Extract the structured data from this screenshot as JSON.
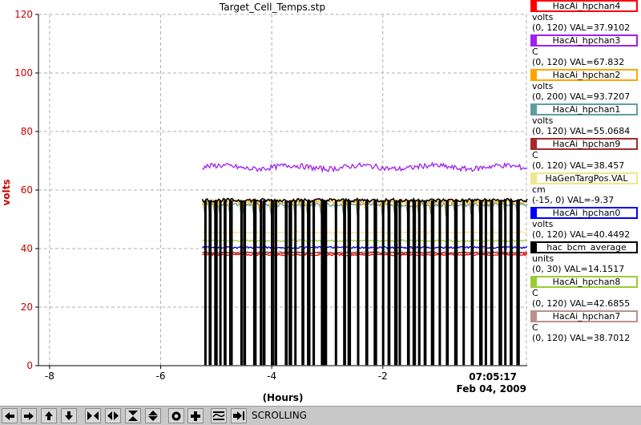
{
  "window": {
    "title": "Target_Cell_Temps.stp"
  },
  "axes": {
    "y_label": "volts",
    "x_label": "(Hours)",
    "x_ticks": [
      "-8",
      "-6",
      "-4",
      "-2"
    ],
    "y_ticks": [
      "0",
      "20",
      "40",
      "60",
      "80",
      "100",
      "120"
    ],
    "timestamp_time": "07:05:17",
    "timestamp_date": "Feb 04, 2009",
    "colors": {
      "y_axis": "#cc0000",
      "grid": "#b0b0b0"
    }
  },
  "chart_data": {
    "type": "line",
    "title": "Target_Cell_Temps.stp",
    "xlabel": "(Hours)",
    "ylabel": "volts",
    "xlim": [
      -8.2,
      0.6
    ],
    "ylim": [
      0,
      120
    ],
    "grid": true,
    "legend_position": "right",
    "series": [
      {
        "name": "HacAi_hpchan4",
        "color": "#ff0000",
        "start": -5.25,
        "level": 37.9
      },
      {
        "name": "HacAi_hpchan3",
        "color": "#a020f0",
        "start": -5.25,
        "level": 67.8
      },
      {
        "name": "HacAi_hpchan2",
        "color": "#ffa500",
        "start": -5.25,
        "level": 56.0
      },
      {
        "name": "HacAi_hpchan1",
        "color": "#5f9ea0",
        "start": -5.25,
        "level": 55.0
      },
      {
        "name": "HacAi_hpchan9",
        "color": "#a52a2a",
        "start": -5.25,
        "level": 38.5
      },
      {
        "name": "HaGenTargPos.VAL",
        "color": "#f0e68c",
        "start": -5.25,
        "level": 45.5
      },
      {
        "name": "HacAi_hpchan0",
        "color": "#0000ff",
        "start": -5.25,
        "level": 40.4
      },
      {
        "name": "hac_bcm_average",
        "color": "#000000",
        "start": -5.25,
        "level": 56.5
      },
      {
        "name": "HacAi_hpchan8",
        "color": "#9acd32",
        "start": -5.25,
        "level": 42.7
      },
      {
        "name": "HacAi_hpchan7",
        "color": "#bc8f8f",
        "start": -5.25,
        "level": 38.7
      }
    ],
    "bcm_dropouts": [
      -5.2,
      -5.12,
      -5.02,
      -4.93,
      -4.85,
      -4.75,
      -4.55,
      -4.5,
      -4.32,
      -4.2,
      -4.15,
      -4.0,
      -3.93,
      -3.75,
      -3.68,
      -3.58,
      -3.45,
      -3.35,
      -3.25,
      -3.1,
      -3.05,
      -2.85,
      -2.7,
      -2.62,
      -2.45,
      -2.3,
      -2.15,
      -2.0,
      -1.9,
      -1.78,
      -1.7,
      -1.55,
      -1.45,
      -1.35,
      -1.25,
      -1.12,
      -0.98,
      -0.85,
      -0.7,
      -0.55,
      -0.4,
      -0.25,
      -0.15,
      -0.05,
      0.1,
      0.2,
      0.3,
      0.42
    ]
  },
  "legend": [
    {
      "name": "HacAi_hpchan4",
      "unit": "volts",
      "range": "(0, 120) VAL=37.9102",
      "color": "#ff0000"
    },
    {
      "name": "HacAi_hpchan3",
      "unit": "C",
      "range": "(0, 120) VAL=67.832",
      "color": "#a020f0"
    },
    {
      "name": "HacAi_hpchan2",
      "unit": "volts",
      "range": "(0, 200) VAL=93.7207",
      "color": "#ffa500"
    },
    {
      "name": "HacAi_hpchan1",
      "unit": "volts",
      "range": "(0, 120) VAL=55.0684",
      "color": "#5f9ea0"
    },
    {
      "name": "HacAi_hpchan9",
      "unit": "C",
      "range": "(0, 120) VAL=38.457",
      "color": "#a52a2a"
    },
    {
      "name": "HaGenTargPos.VAL",
      "unit": "cm",
      "range": "(-15, 0)  VAL=-9.37",
      "color": "#f0e68c"
    },
    {
      "name": "HacAi_hpchan0",
      "unit": "volts",
      "range": "(0, 120) VAL=40.4492",
      "color": "#0000ff"
    },
    {
      "name": "hac_bcm_average",
      "unit": "units",
      "range": "(0, 30) VAL=14.1517",
      "color": "#000000"
    },
    {
      "name": "HacAi_hpchan8",
      "unit": "C",
      "range": "(0, 120) VAL=42.6855",
      "color": "#9acd32"
    },
    {
      "name": "HacAi_hpchan7",
      "unit": "C",
      "range": "(0, 120) VAL=38.7012",
      "color": "#bc8f8f"
    }
  ],
  "toolbar": {
    "status": "SCROLLING",
    "buttons": [
      "arrow-left-icon",
      "arrow-right-icon",
      "arrow-up-icon",
      "arrow-down-icon",
      "expand-horizontal-icon",
      "compress-horizontal-icon",
      "expand-vertical-icon",
      "compress-vertical-icon",
      "record-icon",
      "plus-icon",
      "autoscale-icon",
      "jump-to-now-icon"
    ]
  }
}
